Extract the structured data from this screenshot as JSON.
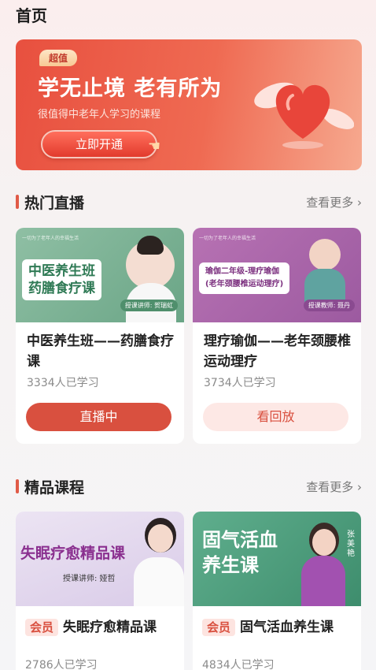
{
  "header": {
    "title": "首页"
  },
  "banner": {
    "badge": "超值",
    "headline": "学无止境 老有所为",
    "subline": "很值得中老年人学习的课程",
    "cta": "立即开通",
    "colors": {
      "start": "#e8503f",
      "end": "#f6a98f"
    }
  },
  "live_section": {
    "title": "热门直播",
    "more": "查看更多",
    "cards": [
      {
        "thumb_title_1": "中医养生班",
        "thumb_title_2": "药膳食疗课",
        "thumb_teacher": "授课讲师: 贺瑞虹",
        "title": "中医养生班——药膳食疗课",
        "count": "3334人已学习",
        "button": "直播中"
      },
      {
        "thumb_title_1": "瑜伽二年级-理疗瑜伽",
        "thumb_title_2": "(老年颈腰椎运动理疗)",
        "thumb_teacher": "授课教师: 聂丹",
        "title": "理疗瑜伽——老年颈腰椎运动理疗",
        "count": "3734人已学习",
        "button": "看回放"
      }
    ]
  },
  "premium_section": {
    "title": "精品课程",
    "more": "查看更多",
    "cards": [
      {
        "thumb_title": "失眠疗愈精品课",
        "thumb_teacher": "授课讲师: 娅哲",
        "tag": "会员",
        "title": "失眠疗愈精品课",
        "count": "2786人已学习"
      },
      {
        "thumb_title_1": "固气活血",
        "thumb_title_2": "养生课",
        "thumb_name": "张美艳",
        "tag": "会员",
        "title": "固气活血养生课",
        "count": "4834人已学习"
      }
    ]
  },
  "icons": {
    "more": "chevron-right-icon",
    "heart": "heart-icon",
    "hand": "hand-pointer-icon"
  }
}
